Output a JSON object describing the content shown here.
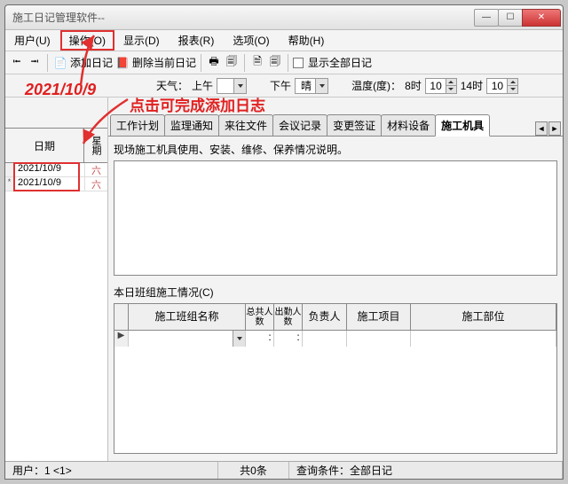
{
  "window": {
    "title": "施工日记管理软件--"
  },
  "menu": {
    "user": "用户(U)",
    "operate": "操作(O)",
    "display": "显示(D)",
    "report": "报表(R)",
    "options": "选项(O)",
    "help": "帮助(H)"
  },
  "toolbar": {
    "add_diary": "添加日记",
    "delete_current": "删除当前日记",
    "show_all": "显示全部日记"
  },
  "weather": {
    "label": "天气：",
    "am_label": "上午",
    "am_value": "",
    "pm_label": "下午",
    "pm_value": "晴",
    "temp_label": "温度(度)：",
    "time8_label": "8时",
    "time8_value": "10",
    "time14_label": "14时",
    "time14_value": "10"
  },
  "annotations": {
    "date": "2021/10/9",
    "tip": "点击可完成添加日志"
  },
  "left": {
    "header_date": "日期",
    "header_week": "星期",
    "rows": [
      {
        "marker": "",
        "date": "2021/10/9",
        "week": "六"
      },
      {
        "marker": "*",
        "date": "2021/10/9",
        "week": "六"
      }
    ]
  },
  "tabs": {
    "items": [
      "工作计划",
      "监理通知",
      "来往文件",
      "会议记录",
      "变更签证",
      "材料设备",
      "施工机具"
    ],
    "active_index": 6
  },
  "machinery": {
    "desc_label": "现场施工机具使用、安装、维修、保养情况说明。"
  },
  "team": {
    "title": "本日班组施工情况(C)",
    "columns": {
      "name": "施工班组名称",
      "total": "总共人数",
      "attend": "出勤人数",
      "leader": "负责人",
      "project": "施工项目",
      "part": "施工部位"
    }
  },
  "status": {
    "user": "用户：1 <1>",
    "count": "共0条",
    "query_label": "查询条件：",
    "query_value": "全部日记"
  }
}
